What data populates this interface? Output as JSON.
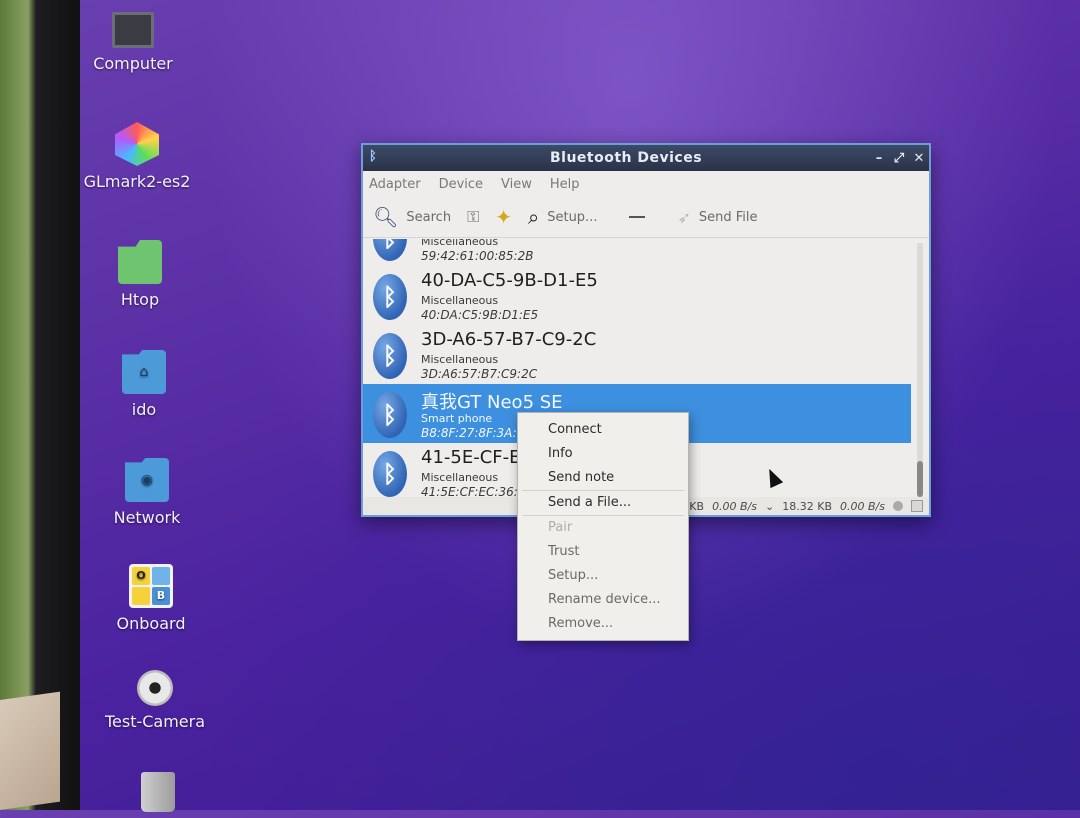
{
  "desktop": {
    "icons": [
      {
        "label": "Computer",
        "icon": "computer-icon"
      },
      {
        "label": "GLmark2-es2",
        "icon": "glmark-icon"
      },
      {
        "label": "Htop",
        "icon": "htop-icon"
      },
      {
        "label": "ido",
        "icon": "home-folder-icon"
      },
      {
        "label": "Network",
        "icon": "network-folder-icon"
      },
      {
        "label": "Onboard",
        "icon": "onboard-icon"
      },
      {
        "label": "Test-Camera",
        "icon": "camera-icon"
      }
    ],
    "onboard_letters": [
      "O",
      "",
      "",
      "B"
    ]
  },
  "window": {
    "title": "Bluetooth Devices",
    "title_icon": "bluetooth-icon",
    "controls": [
      "–",
      "⤢",
      "✕"
    ],
    "menu": [
      "Adapter",
      "Device",
      "View",
      "Help"
    ],
    "toolbar": {
      "search": "Search",
      "setup": "Setup...",
      "send_file": "Send File"
    },
    "devices": [
      {
        "name": "",
        "type": "Miscellaneous",
        "mac": "59:42:61:00:85:2B"
      },
      {
        "name": "40-DA-C5-9B-D1-E5",
        "type": "Miscellaneous",
        "mac": "40:DA:C5:9B:D1:E5"
      },
      {
        "name": "3D-A6-57-B7-C9-2C",
        "type": "Miscellaneous",
        "mac": "3D:A6:57:B7:C9:2C"
      },
      {
        "name": "真我GT Neo5 SE",
        "type": "Smart phone",
        "mac": "B8:8F:27:8F:3A:"
      },
      {
        "name": "41-5E-CF-E",
        "type": "Miscellaneous",
        "mac": "41:5E:CF:EC:36:"
      }
    ],
    "status": {
      "kb1": "KB",
      "down_rate": "0.00 B/s",
      "up_total": "18.32 KB",
      "up_rate": "0.00 B/s"
    }
  },
  "context_menu": {
    "items": [
      "Connect",
      "Info",
      "Send note",
      "Send a File...",
      "Pair",
      "Trust",
      "Setup...",
      "Rename device...",
      "Remove..."
    ]
  },
  "colors": {
    "desktop_bg": "#5a2fa5",
    "selection": "#3d8fdf",
    "titlebar": "#2a3248"
  }
}
